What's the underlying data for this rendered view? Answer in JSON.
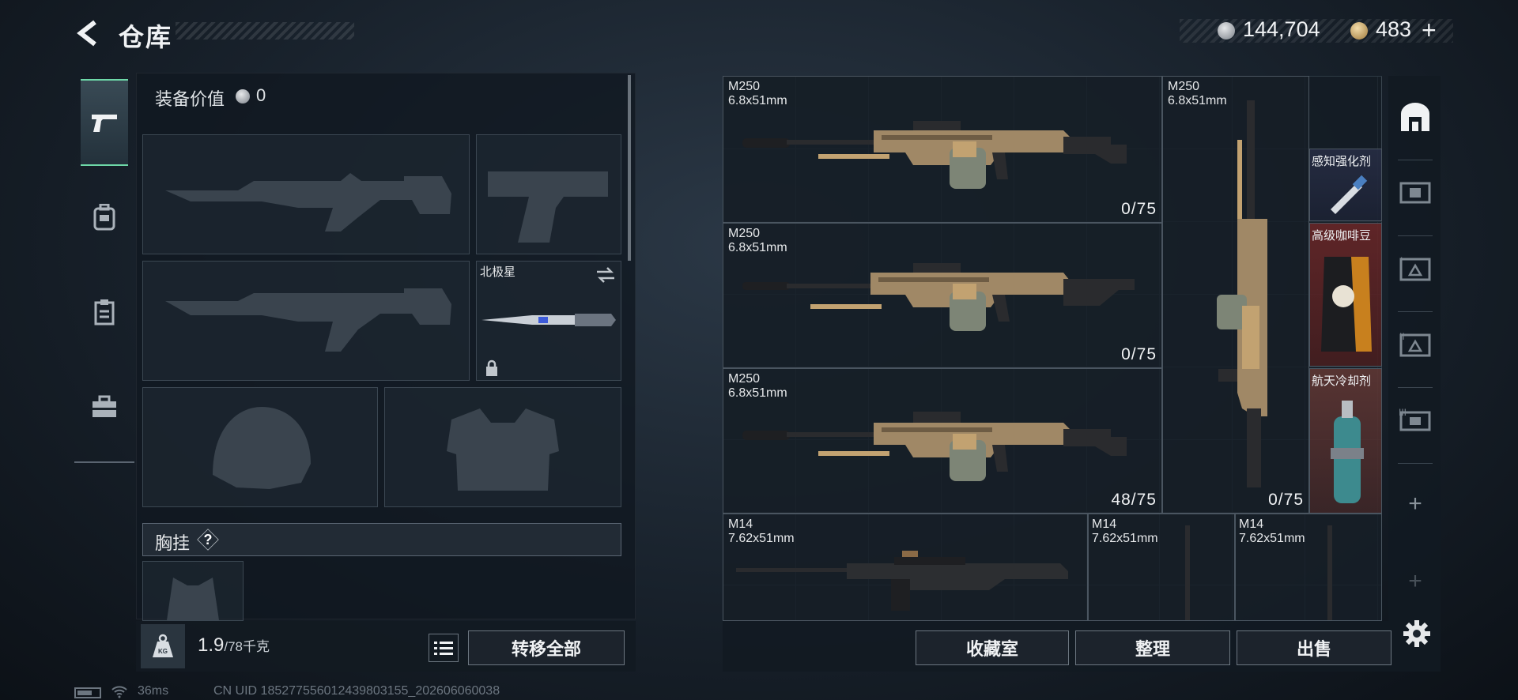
{
  "header": {
    "title": "仓库",
    "currency_silver": "144,704",
    "currency_gold": "483",
    "add_label": "+"
  },
  "nav": {
    "items": [
      {
        "name": "weapons",
        "icon": "pistol-icon",
        "active": true
      },
      {
        "name": "gear",
        "icon": "backpack-icon",
        "active": false
      },
      {
        "name": "container",
        "icon": "clipboard-icon",
        "active": false
      },
      {
        "name": "tools",
        "icon": "toolbox-icon",
        "active": false
      }
    ]
  },
  "equipment": {
    "value_label": "装备价值",
    "value": "0",
    "melee_name": "北极星",
    "chest_label": "胸挂",
    "help_label": "?"
  },
  "weight": {
    "current": "1.9",
    "max": "/78千克"
  },
  "actions": {
    "transfer_all": "转移全部",
    "collection": "收藏室",
    "organize": "整理",
    "sell": "出售"
  },
  "storage": {
    "items": [
      {
        "name": "M250",
        "ammo": "6.8x51mm",
        "count": "0/75"
      },
      {
        "name": "M250",
        "ammo": "6.8x51mm",
        "count": "0/75"
      },
      {
        "name": "M250",
        "ammo": "6.8x51mm",
        "count": "48/75"
      },
      {
        "name": "M250",
        "ammo": "6.8x51mm",
        "count": "0/75"
      },
      {
        "name": "M14",
        "ammo": "7.62x51mm",
        "count": ""
      },
      {
        "name": "M14",
        "ammo": "7.62x51mm",
        "count": ""
      },
      {
        "name": "M14",
        "ammo": "7.62x51mm",
        "count": ""
      }
    ],
    "consumables": [
      {
        "name": "感知强化剂"
      },
      {
        "name": "高级咖啡豆"
      },
      {
        "name": "航天冷却剂"
      }
    ]
  },
  "right_tabs": {
    "add_label": "+"
  },
  "status": {
    "ping": "36ms",
    "uid": "CN UID 1852775560124398031​55_202606060038"
  }
}
